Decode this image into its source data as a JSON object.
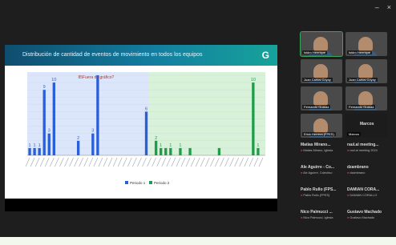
{
  "window": {
    "minimize": "–",
    "close": "×"
  },
  "slide": {
    "title": "Distribución de cantidad de eventos de movimiento en todos los equipos",
    "logo": "G"
  },
  "chart_data": {
    "type": "bar",
    "title": "Distribución de cantidad de eventos de movimiento en todos los equipos",
    "ylim": [
      0,
      11
    ],
    "annotation": "85Fuera de gráfico?",
    "series": [
      {
        "name": "Periodo 1",
        "color": "#2b5fd9",
        "bars": [
          {
            "i": 0,
            "v": 1
          },
          {
            "i": 1,
            "v": 1
          },
          {
            "i": 2,
            "v": 1
          },
          {
            "i": 3,
            "v": 9
          },
          {
            "i": 4,
            "v": 3
          },
          {
            "i": 5,
            "v": 10
          },
          {
            "i": 10,
            "v": 2
          },
          {
            "i": 13,
            "v": 3
          },
          {
            "i": 14,
            "v": 11
          },
          {
            "i": 24,
            "v": 6
          }
        ]
      },
      {
        "name": "Periodo 2",
        "color": "#1f9d4a",
        "bars": [
          {
            "i": 26,
            "v": 2
          },
          {
            "i": 27,
            "v": 1
          },
          {
            "i": 28,
            "v": 1
          },
          {
            "i": 29,
            "v": 1
          },
          {
            "i": 31,
            "v": 1
          },
          {
            "i": 33,
            "v": 1
          },
          {
            "i": 39,
            "v": 1
          },
          {
            "i": 46,
            "v": 10
          },
          {
            "i": 47,
            "v": 1
          }
        ]
      }
    ],
    "data_labels": [
      {
        "i": 0,
        "text": "1"
      },
      {
        "i": 1,
        "text": "1"
      },
      {
        "i": 2,
        "text": "1"
      },
      {
        "i": 3,
        "text": "9"
      },
      {
        "i": 4,
        "text": "3"
      },
      {
        "i": 5,
        "text": "10"
      },
      {
        "i": 10,
        "text": "2"
      },
      {
        "i": 13,
        "text": "3"
      },
      {
        "i": 24,
        "text": "6"
      },
      {
        "i": 26,
        "text": "2"
      },
      {
        "i": 27,
        "text": "1"
      },
      {
        "i": 29,
        "text": "1"
      },
      {
        "i": 31,
        "text": "1"
      },
      {
        "i": 46,
        "text": "10"
      },
      {
        "i": 47,
        "text": "1"
      }
    ],
    "legend": [
      "Periodo 1",
      "Periodo 2"
    ],
    "category_count": 49,
    "period1_range": [
      0,
      24
    ],
    "period2_range": [
      25,
      48
    ],
    "colors": {
      "p1_bg": "#dbe6fb",
      "p2_bg": "#d7f2d8"
    }
  },
  "participants": [
    {
      "caption": "Isidro Henrique"
    },
    {
      "caption": "Isidro Henrique"
    },
    {
      "caption": "Juan Carlos Coyoy"
    },
    {
      "caption": "Juan Carlos Coyoy"
    },
    {
      "caption": "Fernando Guaraz"
    },
    {
      "caption": "Fernando Guaraz"
    },
    {
      "caption": "Erick Herrera (FPES)"
    },
    {
      "caption": "Marcos"
    }
  ],
  "name_tiles": [
    {
      "name": "Matias Mirano...",
      "sub": "Matias Mirano, Iglesia"
    },
    {
      "name": "raul.al meeting...",
      "sub": "raul.al meeting 2024"
    },
    {
      "name": "Ale Aguirre - Co...",
      "sub": "Ale Aguirre, Colectivo"
    },
    {
      "name": "dzambrano",
      "sub": "dzambrano"
    },
    {
      "name": "Pablo Rullo (FPS...",
      "sub": "Pablo Rullo (FPES)"
    },
    {
      "name": "DAMIAN CORA...",
      "sub": "DAMIAN CORALLO"
    },
    {
      "name": "Nico Palmucci ...",
      "sub": "Nico Palmucci, Iglesia"
    },
    {
      "name": "Gustavo Machado",
      "sub": "Gustavo Machado"
    }
  ]
}
